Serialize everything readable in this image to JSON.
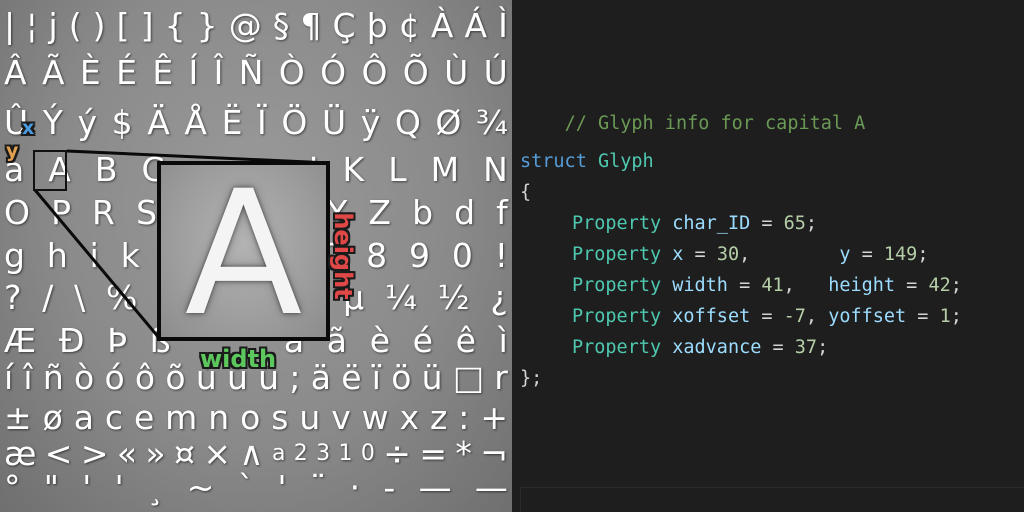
{
  "atlas": {
    "rows": [
      [
        "|",
        "¦",
        "j",
        "(",
        ")",
        "[",
        "]",
        "{",
        "}",
        "@",
        "§",
        "¶",
        "Ç",
        "þ",
        "¢",
        "À",
        "Á",
        "Ì"
      ],
      [
        "Â",
        "Ã",
        "È",
        "É",
        "Ê",
        "Í",
        "Î",
        "Ñ",
        "Ò",
        "Ó",
        "Ô",
        "Õ",
        "Ù",
        "Ú"
      ],
      [
        "Û",
        "Ý",
        "ý",
        "$",
        "Ä",
        "Å",
        "Ë",
        "Ï",
        "Ö",
        "Ü",
        "ÿ",
        "Q",
        "Ø",
        "¾"
      ],
      [
        "a",
        "A",
        "B",
        "C",
        "",
        "",
        "",
        "",
        "",
        "J",
        "K",
        "L",
        "M",
        "N"
      ],
      [
        "O",
        "P",
        "R",
        "S",
        "",
        "",
        "",
        "",
        "",
        "X",
        "Y",
        "Z",
        "b",
        "d",
        "f"
      ],
      [
        "g",
        "h",
        "i",
        "k",
        "l",
        "p",
        "",
        "",
        "",
        "",
        "7",
        "8",
        "9",
        "0",
        "!"
      ],
      [
        "?",
        "/",
        "\\",
        "%",
        "#",
        "",
        "",
        "",
        "",
        "©",
        "µ",
        "¼",
        "½",
        "¿"
      ],
      [
        "Æ",
        "Ð",
        "Þ",
        "ß",
        "",
        "",
        "",
        "",
        "â",
        "ã",
        "è",
        "é",
        "ê",
        "ì"
      ],
      [
        "í",
        "î",
        "ñ",
        "ò",
        "ó",
        "ô",
        "õ",
        "ù",
        "ú",
        "û",
        ";",
        "ä",
        "ë",
        "ï",
        "ö",
        "ü",
        "□",
        "r"
      ],
      [
        "±",
        "ø",
        "a",
        "c",
        "e",
        "m",
        "n",
        "o",
        "s",
        "u",
        "v",
        "w",
        "x",
        "z",
        ":",
        "+"
      ],
      [
        "æ",
        "<",
        ">",
        "«",
        "»",
        "¤",
        "×",
        "∧",
        "a",
        "2",
        "3",
        "1",
        "0",
        "÷",
        "=",
        "*",
        "¬"
      ],
      [
        "°",
        "\"",
        "'",
        "'",
        "¸",
        "~",
        "`",
        "'",
        "¨",
        "·",
        "-",
        "—",
        "—"
      ]
    ],
    "selected_glyph": "A",
    "zoom_glyph": "A",
    "labels": {
      "x": "x",
      "y": "y",
      "width": "width",
      "height": "height"
    },
    "colors": {
      "x": "#4a9be0",
      "y": "#e0a050",
      "width": "#5cc75c",
      "height": "#e04848"
    }
  },
  "code": {
    "comment": "// Glyph info for capital A",
    "struct_keyword": "struct",
    "struct_name": "Glyph",
    "open_brace": "{",
    "close_brace": "};",
    "property_keyword": "Property",
    "char_id": {
      "name": "char_ID",
      "value": "65"
    },
    "x": {
      "name": "x",
      "value": "30"
    },
    "y": {
      "name": "y",
      "value": "149"
    },
    "width": {
      "name": "width",
      "value": "41"
    },
    "height": {
      "name": "height",
      "value": "42"
    },
    "xoffset": {
      "name": "xoffset",
      "value": "-7"
    },
    "yoffset": {
      "name": "yoffset",
      "value": "1"
    },
    "xadvance": {
      "name": "xadvance",
      "value": "37"
    }
  }
}
